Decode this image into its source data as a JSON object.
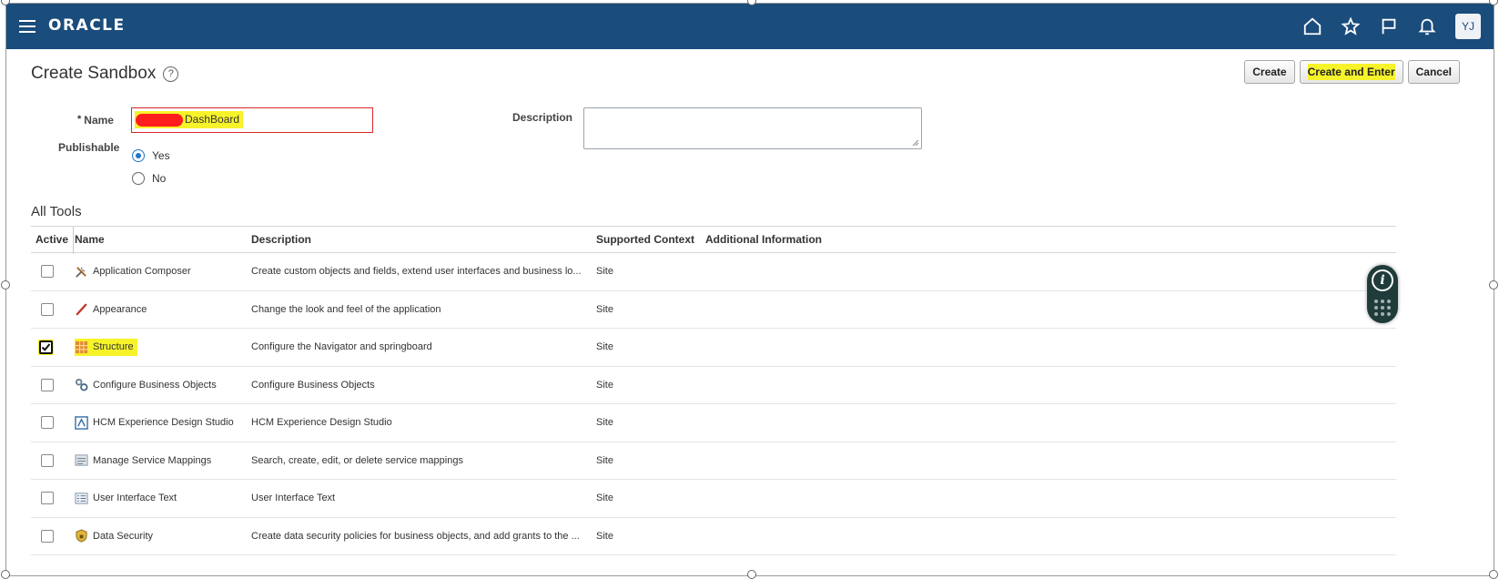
{
  "header": {
    "logo": "ORACLE",
    "icons": [
      "home-icon",
      "star-icon",
      "flag-icon",
      "bell-icon"
    ],
    "avatar_initials": "YJ",
    "bg_color": "#1a4c7c"
  },
  "page": {
    "title": "Create Sandbox",
    "help_glyph": "?",
    "buttons": {
      "create": "Create",
      "create_and_enter": "Create and Enter",
      "cancel": "Cancel"
    }
  },
  "form": {
    "name_label": "Name",
    "required_mark": "*",
    "name_value_visible": "DashBoard",
    "description_label": "Description",
    "description_value": "",
    "publishable_label": "Publishable",
    "publishable_options": [
      {
        "label": "Yes",
        "selected": true
      },
      {
        "label": "No",
        "selected": false
      }
    ]
  },
  "tools": {
    "section_title": "All Tools",
    "columns": {
      "active": "Active",
      "name": "Name",
      "description": "Description",
      "context": "Supported Context",
      "info": "Additional Information"
    },
    "rows": [
      {
        "name": "Application Composer",
        "description": "Create custom objects and fields, extend user interfaces and business lo...",
        "context": "Site",
        "active": false,
        "icon": "tools-icon"
      },
      {
        "name": "Appearance",
        "description": "Change the look and feel of the application",
        "context": "Site",
        "active": false,
        "icon": "brush-icon"
      },
      {
        "name": "Structure",
        "description": "Configure the Navigator and springboard",
        "context": "Site",
        "active": true,
        "icon": "grid-icon"
      },
      {
        "name": "Configure Business Objects",
        "description": "Configure Business Objects",
        "context": "Site",
        "active": false,
        "icon": "gears-icon"
      },
      {
        "name": "HCM Experience Design Studio",
        "description": "HCM Experience Design Studio",
        "context": "Site",
        "active": false,
        "icon": "design-studio-icon"
      },
      {
        "name": "Manage Service Mappings",
        "description": "Search, create, edit, or delete service mappings",
        "context": "Site",
        "active": false,
        "icon": "mapping-icon"
      },
      {
        "name": "User Interface Text",
        "description": "User Interface Text",
        "context": "Site",
        "active": false,
        "icon": "text-list-icon"
      },
      {
        "name": "Data Security",
        "description": "Create data security policies for business objects, and add grants to the ...",
        "context": "Site",
        "active": false,
        "icon": "shield-icon"
      }
    ]
  },
  "widget": {
    "info_glyph": "i"
  }
}
